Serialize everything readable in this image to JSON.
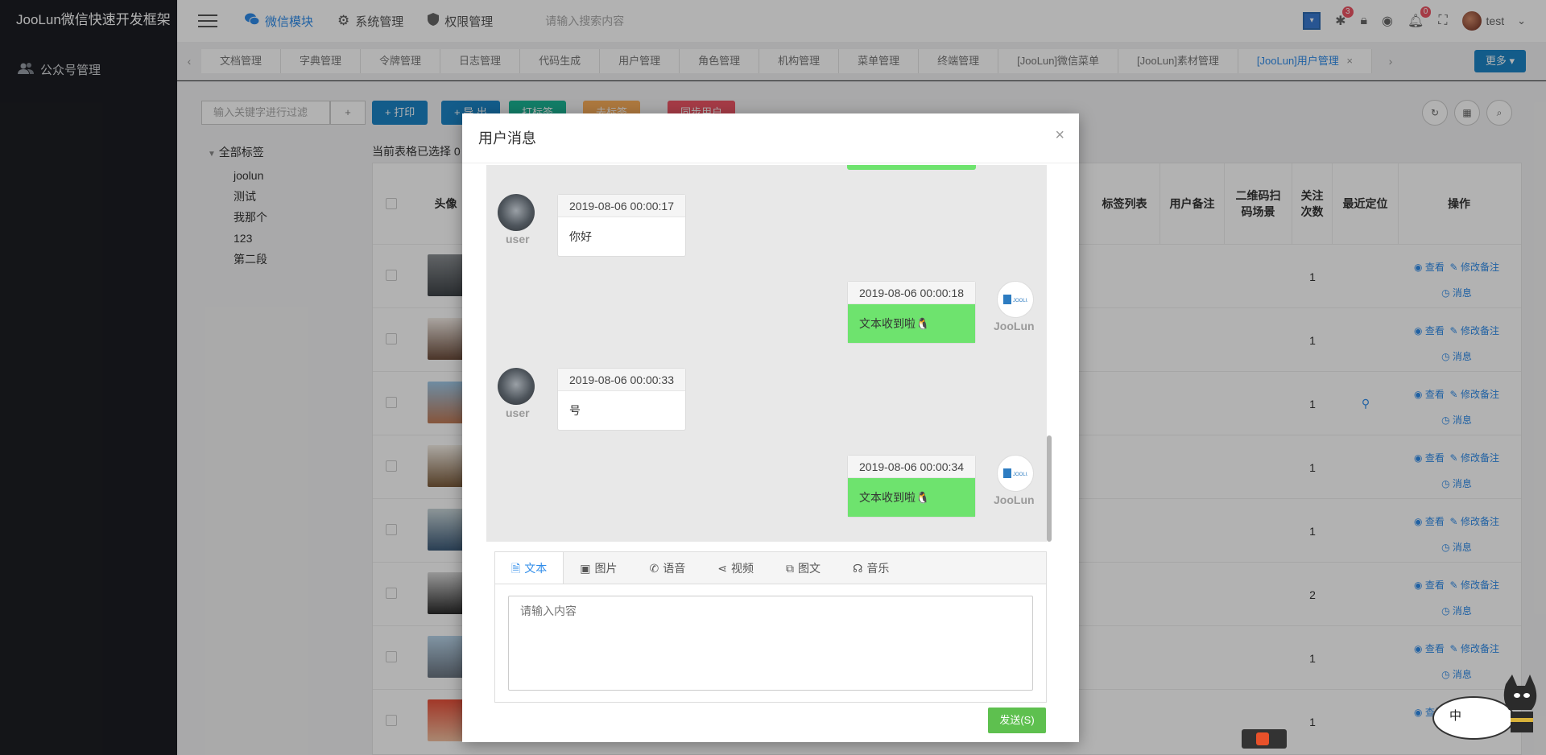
{
  "app": {
    "title": "JooLun微信快速开发框架"
  },
  "sidebar": {
    "items": [
      {
        "label": "公众号管理",
        "icon": "users-icon"
      }
    ]
  },
  "header": {
    "menu": [
      {
        "label": "微信模块",
        "icon": "wechat-icon",
        "active": true
      },
      {
        "label": "系统管理",
        "icon": "gear-icon",
        "active": false
      },
      {
        "label": "权限管理",
        "icon": "shield-icon",
        "active": false
      }
    ],
    "search_placeholder": "请输入搜索内容",
    "bug_count": "3",
    "notice_count": "0",
    "username": "test"
  },
  "tabs": {
    "items": [
      "文档管理",
      "字典管理",
      "令牌管理",
      "日志管理",
      "代码生成",
      "用户管理",
      "角色管理",
      "机构管理",
      "菜单管理",
      "终端管理",
      "[JooLun]微信菜单",
      "[JooLun]素材管理",
      "[JooLun]用户管理"
    ],
    "more_label": "更多"
  },
  "toolbar": {
    "filter_placeholder": "输入关键字进行过滤",
    "add_label": "+",
    "print_label": "+ 打印",
    "export_label": "+ 导 出",
    "tag_label": "打标签",
    "untag_label": "去标签",
    "sync_label": "同步用户"
  },
  "tree": {
    "root": "全部标签",
    "children": [
      "joolun",
      "测试",
      "我那个",
      "123",
      "第二段"
    ]
  },
  "table": {
    "selected_text": "当前表格已选择 0",
    "headers": {
      "avatar": "头像",
      "tags": "标签列表",
      "remark": "用户备注",
      "qr": "二维码扫码场景",
      "subscribe": "关注次数",
      "location": "最近定位",
      "ops": "操作"
    },
    "rows": [
      {
        "subscribe": "1",
        "location": ""
      },
      {
        "subscribe": "1",
        "location": ""
      },
      {
        "subscribe": "1",
        "location": "⚲"
      },
      {
        "subscribe": "1",
        "location": ""
      },
      {
        "subscribe": "1",
        "location": ""
      },
      {
        "subscribe": "2",
        "location": ""
      },
      {
        "subscribe": "1",
        "location": ""
      },
      {
        "subscribe": "1",
        "location": ""
      }
    ],
    "op_view": "查看",
    "op_edit": "修改备注",
    "op_msg": "消息"
  },
  "modal": {
    "title": "用户消息",
    "close": "×",
    "messages": [
      {
        "from": "user",
        "name": "user",
        "time": "2019-08-06 00:00:17",
        "text": "你好"
      },
      {
        "from": "me",
        "name": "JooLun",
        "time": "2019-08-06 00:00:18",
        "text": "文本收到啦🐧"
      },
      {
        "from": "user",
        "name": "user",
        "time": "2019-08-06 00:00:33",
        "text": "号"
      },
      {
        "from": "me",
        "name": "JooLun",
        "time": "2019-08-06 00:00:34",
        "text": "文本收到啦🐧"
      }
    ],
    "editor_tabs": [
      {
        "label": "文本",
        "icon": "file-text-icon",
        "active": true
      },
      {
        "label": "图片",
        "icon": "image-icon",
        "active": false
      },
      {
        "label": "语音",
        "icon": "phone-icon",
        "active": false
      },
      {
        "label": "视频",
        "icon": "share-icon",
        "active": false
      },
      {
        "label": "图文",
        "icon": "external-link-icon",
        "active": false
      },
      {
        "label": "音乐",
        "icon": "headphones-icon",
        "active": false
      }
    ],
    "input_placeholder": "请输入内容",
    "send_label": "发送(S)"
  },
  "ime": {
    "lang": "中"
  },
  "colors": {
    "primary": "#2f8cea",
    "send": "#5ec04f",
    "bubble_me": "#6ee36e",
    "sidebar": "#1c1e23"
  }
}
